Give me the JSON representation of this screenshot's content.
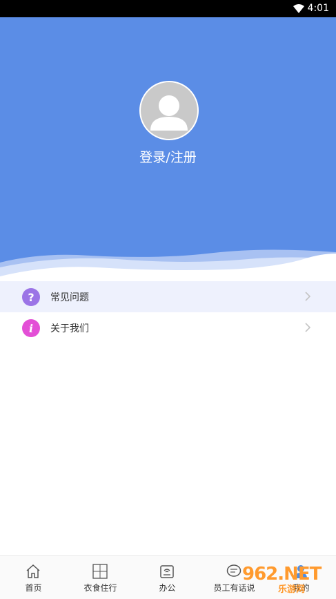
{
  "status": {
    "time": "4:01"
  },
  "profile": {
    "login_label": "登录/注册"
  },
  "menu": {
    "items": [
      {
        "label": "常见问题",
        "icon": "question-icon",
        "color": "#9b74e6"
      },
      {
        "label": "关于我们",
        "icon": "info-icon",
        "color": "#e34fd6"
      }
    ]
  },
  "tabs": [
    {
      "label": "首页",
      "icon": "home-icon"
    },
    {
      "label": "衣食住行",
      "icon": "grid-icon"
    },
    {
      "label": "办公",
      "icon": "office-icon"
    },
    {
      "label": "员工有话说",
      "icon": "chat-icon"
    },
    {
      "label": "我的",
      "icon": "user-icon"
    }
  ],
  "watermark": {
    "brand": "962.NET",
    "sub": "乐游网"
  },
  "colors": {
    "header": "#5b8de6",
    "status_bar": "#000000",
    "active_row": "#eef1fd"
  }
}
